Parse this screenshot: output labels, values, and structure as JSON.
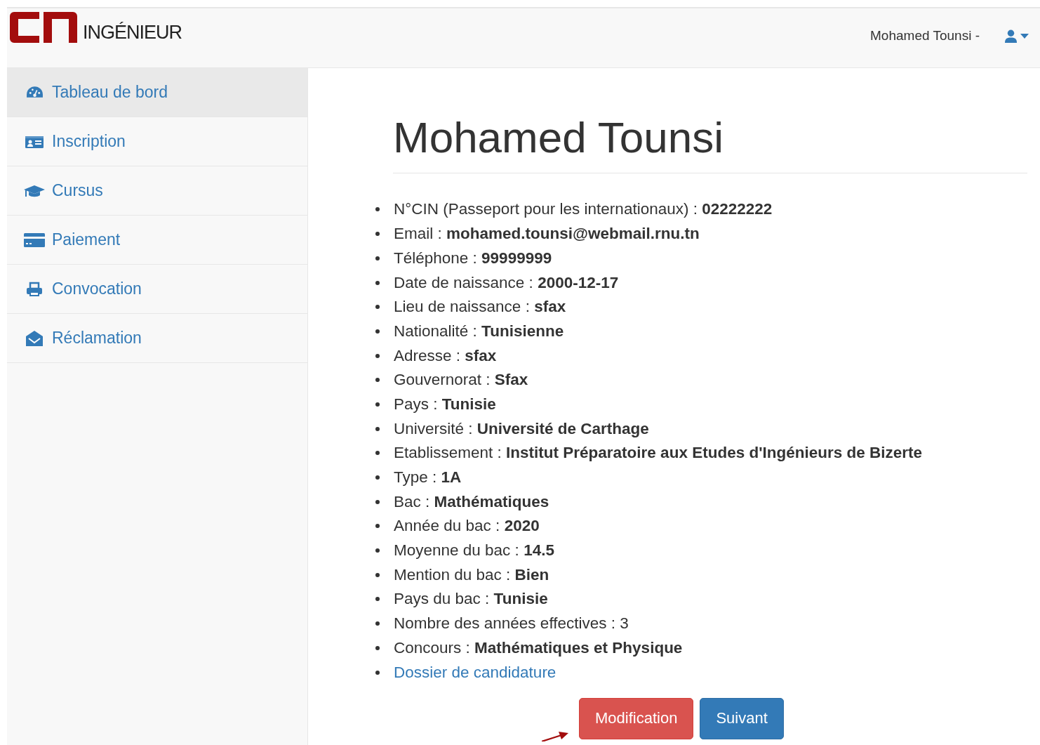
{
  "header": {
    "brand": "INGÉNIEUR",
    "user": "Mohamed Tounsi -"
  },
  "sidebar": {
    "items": [
      {
        "label": "Tableau de bord",
        "selected": true
      },
      {
        "label": "Inscription",
        "selected": false
      },
      {
        "label": "Cursus",
        "selected": false
      },
      {
        "label": "Paiement",
        "selected": false
      },
      {
        "label": "Convocation",
        "selected": false
      },
      {
        "label": "Réclamation",
        "selected": false
      }
    ]
  },
  "profile": {
    "title": "Mohamed Tounsi",
    "details": [
      {
        "kind": "field",
        "label": "N°CIN (Passeport pour les internationaux) :",
        "value": "02222222",
        "value_bold": true
      },
      {
        "kind": "field",
        "label": "Email :",
        "value": "mohamed.tounsi@webmail.rnu.tn",
        "value_bold": true
      },
      {
        "kind": "field",
        "label": "Téléphone :",
        "value": "99999999",
        "value_bold": true
      },
      {
        "kind": "field",
        "label": "Date de naissance :",
        "value": "2000-12-17",
        "value_bold": true
      },
      {
        "kind": "field",
        "label": "Lieu de naissance :",
        "value": "sfax",
        "value_bold": true
      },
      {
        "kind": "field",
        "label": "Nationalité :",
        "value": "Tunisienne",
        "value_bold": true
      },
      {
        "kind": "field",
        "label": "Adresse :",
        "value": "sfax",
        "value_bold": true
      },
      {
        "kind": "field",
        "label": "Gouvernorat :",
        "value": "Sfax",
        "value_bold": true
      },
      {
        "kind": "field",
        "label": "Pays :",
        "value": "Tunisie",
        "value_bold": true
      },
      {
        "kind": "field",
        "label": "Université :",
        "value": "Université de Carthage",
        "value_bold": true
      },
      {
        "kind": "field",
        "label": "Etablissement :",
        "value": "Institut Préparatoire aux Etudes d'Ingénieurs de Bizerte",
        "value_bold": true
      },
      {
        "kind": "field",
        "label": "Type :",
        "value": "1A",
        "value_bold": true
      },
      {
        "kind": "field",
        "label": "Bac :",
        "value": "Mathématiques",
        "value_bold": true
      },
      {
        "kind": "field",
        "label": "Année du bac :",
        "value": "2020",
        "value_bold": true
      },
      {
        "kind": "field",
        "label": "Moyenne du bac :",
        "value": "14.5",
        "value_bold": true
      },
      {
        "kind": "field",
        "label": "Mention du bac :",
        "value": "Bien",
        "value_bold": true
      },
      {
        "kind": "field",
        "label": "Pays du bac :",
        "value": "Tunisie",
        "value_bold": true
      },
      {
        "kind": "field",
        "label": "Nombre des années effectives :",
        "value": "3",
        "value_bold": false
      },
      {
        "kind": "field",
        "label": "Concours :",
        "value": "Mathématiques et Physique",
        "value_bold": true
      },
      {
        "kind": "link",
        "label": "Dossier de candidature"
      }
    ]
  },
  "buttons": [
    {
      "label": "Modification",
      "kind": "danger"
    },
    {
      "label": "Suivant",
      "kind": "primary"
    }
  ]
}
